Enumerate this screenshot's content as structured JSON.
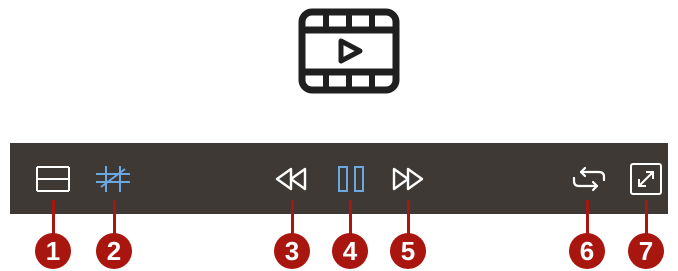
{
  "hero": {
    "icon": "film-play-icon"
  },
  "toolbar": {
    "background": "#3e3934",
    "controls": [
      {
        "name": "fit-height-icon",
        "callout": "1",
        "active": false
      },
      {
        "name": "fit-width-icon",
        "callout": "2",
        "active": true
      },
      {
        "name": "rewind-icon",
        "callout": "3",
        "active": false
      },
      {
        "name": "pause-icon",
        "callout": "4",
        "active": true
      },
      {
        "name": "fast-forward-icon",
        "callout": "5",
        "active": false
      },
      {
        "name": "loop-icon",
        "callout": "6",
        "active": false
      },
      {
        "name": "fullscreen-icon",
        "callout": "7",
        "active": false
      }
    ]
  },
  "colors": {
    "icon_default": "#ffffff",
    "icon_active": "#6aa8e4",
    "callout": "#a8160f"
  }
}
